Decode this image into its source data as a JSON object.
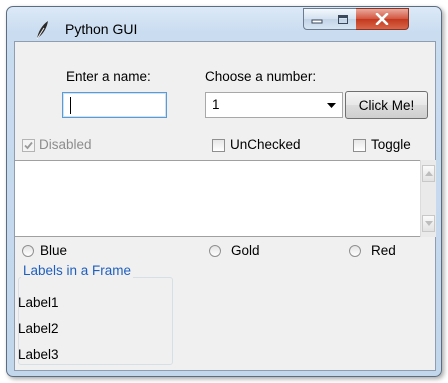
{
  "window": {
    "title": "Python GUI",
    "icon": "feather-icon",
    "controls": {
      "minimize": "minimize-icon",
      "maximize": "maximize-icon",
      "close": "close-icon"
    }
  },
  "form": {
    "name_label": "Enter a name:",
    "name_value": "",
    "number_label": "Choose a number:",
    "number_value": "1",
    "button_label": "Click Me!"
  },
  "checkboxes": [
    {
      "label": "Disabled",
      "checked": true,
      "enabled": false
    },
    {
      "label": "UnChecked",
      "checked": false,
      "enabled": true
    },
    {
      "label": "Toggle",
      "checked": false,
      "enabled": true
    }
  ],
  "scrolled_text": {
    "value": ""
  },
  "radios": [
    {
      "label": "Blue",
      "selected": false
    },
    {
      "label": "Gold",
      "selected": false
    },
    {
      "label": "Red",
      "selected": false
    }
  ],
  "frame": {
    "title": "Labels in a Frame",
    "labels": [
      "Label1",
      "Label2",
      "Label3"
    ]
  },
  "colors": {
    "frame_title": "#1f5fbf",
    "disabled_text": "#8d8d8d",
    "close_button": "#c3381d"
  }
}
